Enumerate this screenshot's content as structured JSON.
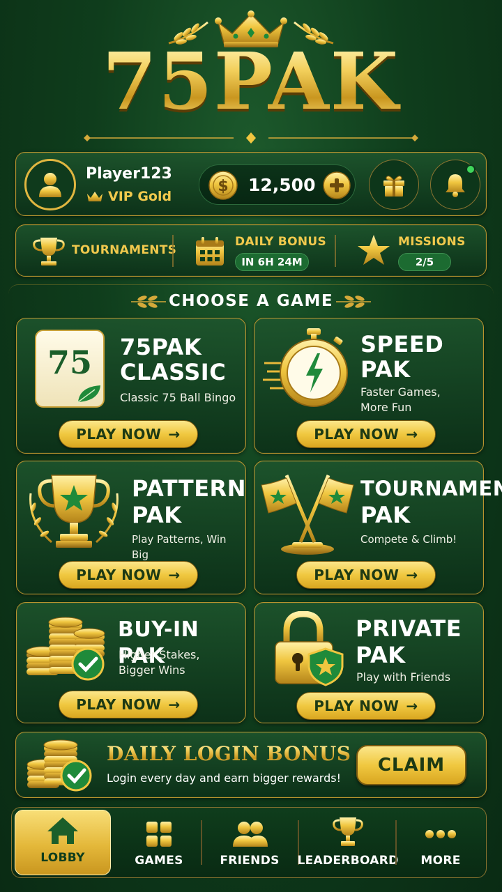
{
  "app": {
    "title": "75PAK"
  },
  "profile": {
    "player_name": "Player123",
    "vip_level": "VIP Gold",
    "coins": "12,500"
  },
  "quick_bar": {
    "tournaments": "TOURNAMENTS",
    "daily_bonus_label": "DAILY BONUS",
    "daily_bonus_timer": "IN 6H 24M",
    "missions_label": "MISSIONS",
    "missions_progress": "2/5"
  },
  "games_section": {
    "title": "CHOOSE A GAME",
    "play_label": "PLAY NOW",
    "games": [
      {
        "name_line1": "75PAK",
        "name_line2": "CLASSIC",
        "subtitle_line1": "Classic 75 Ball Bingo",
        "subtitle_line2": "",
        "badge": "75"
      },
      {
        "name_line1": "SPEED",
        "name_line2": "PAK",
        "subtitle_line1": "Faster Games,",
        "subtitle_line2": "More Fun"
      },
      {
        "name_line1": "PATTERN",
        "name_line2": "PAK",
        "subtitle_line1": "Play Patterns, Win Big",
        "subtitle_line2": ""
      },
      {
        "name_line1": "TOURNAMENT",
        "name_line2": "PAK",
        "subtitle_line1": "Compete & Climb!",
        "subtitle_line2": ""
      },
      {
        "name_line1": "BUY-IN PAK",
        "name_line2": "",
        "subtitle_line1": "Higher Stakes,",
        "subtitle_line2": "Bigger Wins"
      },
      {
        "name_line1": "PRIVATE",
        "name_line2": "PAK",
        "subtitle_line1": "Play with Friends",
        "subtitle_line2": ""
      }
    ]
  },
  "daily_login": {
    "title": "DAILY LOGIN BONUS",
    "subtitle": "Login every day and earn bigger rewards!",
    "claim": "CLAIM"
  },
  "nav": {
    "items": [
      {
        "label": "LOBBY",
        "icon": "home-icon",
        "active": true
      },
      {
        "label": "GAMES",
        "icon": "grid-icon"
      },
      {
        "label": "FRIENDS",
        "icon": "friends-icon"
      },
      {
        "label": "LEADERBOARD",
        "icon": "trophy-icon"
      },
      {
        "label": "MORE",
        "icon": "more-icon"
      }
    ]
  },
  "colors": {
    "background": "#0f3d1c",
    "gold": "#f1c94d",
    "accent_green": "#1c6b31"
  }
}
